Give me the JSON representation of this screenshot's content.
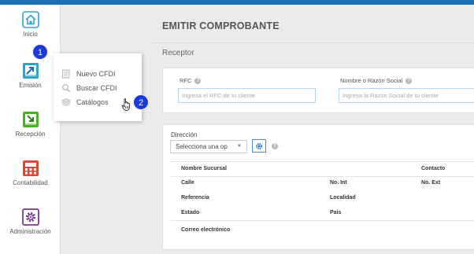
{
  "sidebar": {
    "items": [
      {
        "label": "Inicio",
        "icon": "home-icon"
      },
      {
        "label": "Emisión",
        "icon": "invoice-icon"
      },
      {
        "label": "Recepción",
        "icon": "inbox-icon"
      },
      {
        "label": "Contabilidad",
        "icon": "calculator-icon"
      },
      {
        "label": "Administración",
        "icon": "gear-icon"
      }
    ]
  },
  "steps": [
    "1",
    "2"
  ],
  "flyout": {
    "items": [
      {
        "label": "Nuevo CFDI",
        "icon": "document-icon"
      },
      {
        "label": "Buscar CFDI",
        "icon": "search-icon"
      },
      {
        "label": "Catálogos",
        "icon": "stack-icon"
      }
    ]
  },
  "page": {
    "title": "EMITIR COMPROBANTE",
    "section": "Receptor"
  },
  "receptor": {
    "rfc_label": "RFC",
    "rfc_placeholder": "Ingresa el RFC de tu cliente",
    "name_label": "Nombre o Razón Social",
    "name_placeholder": "Ingresa la Razón Social de tu cliente"
  },
  "direccion": {
    "label": "Dirección",
    "select_value": "Selecciona una op",
    "table": {
      "nombre_sucursal": "Nombre Sucursal",
      "contacto": "Contacto",
      "calle": "Calle",
      "no_int": "No. Int",
      "no_ext": "No. Ext",
      "referencia": "Referencia",
      "localidad": "Localidad",
      "estado": "Estado",
      "pais": "País",
      "correo": "Correo electrónico"
    }
  },
  "colors": {
    "accent": "#1a6fb5",
    "step_badge": "#1d3ad6",
    "icon_teal": "#2fa3c9",
    "icon_green": "#4caf2a",
    "icon_red": "#d9493a",
    "icon_purple": "#7b3a8e"
  }
}
